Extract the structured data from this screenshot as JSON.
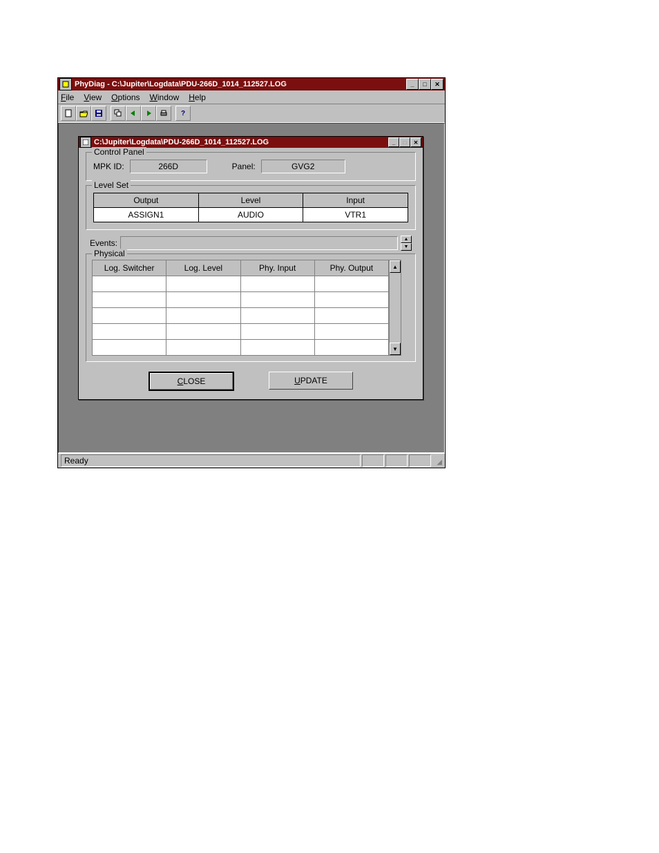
{
  "outer_window": {
    "title": "PhyDiag - C:\\Jupiter\\Logdata\\PDU-266D_1014_112527.LOG"
  },
  "menu": {
    "file": "File",
    "view": "View",
    "options": "Options",
    "window": "Window",
    "help": "Help"
  },
  "toolbar": {
    "icons": [
      "new",
      "open",
      "save",
      "cascade",
      "prev",
      "next",
      "print",
      "help"
    ]
  },
  "child_window": {
    "title": "C:\\Jupiter\\Logdata\\PDU-266D_1014_112527.LOG"
  },
  "control_panel": {
    "legend": "Control Panel",
    "mpk_label": "MPK ID:",
    "mpk_value": "266D",
    "panel_label": "Panel:",
    "panel_value": "GVG2"
  },
  "level_set": {
    "legend": "Level Set",
    "headers": {
      "output": "Output",
      "level": "Level",
      "input": "Input"
    },
    "values": {
      "output": "ASSIGN1",
      "level": "AUDIO",
      "input": "VTR1"
    }
  },
  "events": {
    "label": "Events:",
    "value": ""
  },
  "physical": {
    "legend": "Physical",
    "headers": {
      "log_switcher": "Log. Switcher",
      "log_level": "Log. Level",
      "phy_input": "Phy. Input",
      "phy_output": "Phy. Output"
    },
    "rows": [
      [
        "",
        "",
        "",
        ""
      ],
      [
        "",
        "",
        "",
        ""
      ],
      [
        "",
        "",
        "",
        ""
      ],
      [
        "",
        "",
        "",
        ""
      ],
      [
        "",
        "",
        "",
        ""
      ]
    ]
  },
  "buttons": {
    "close": "CLOSE",
    "update": "UPDATE"
  },
  "status": {
    "text": "Ready"
  }
}
